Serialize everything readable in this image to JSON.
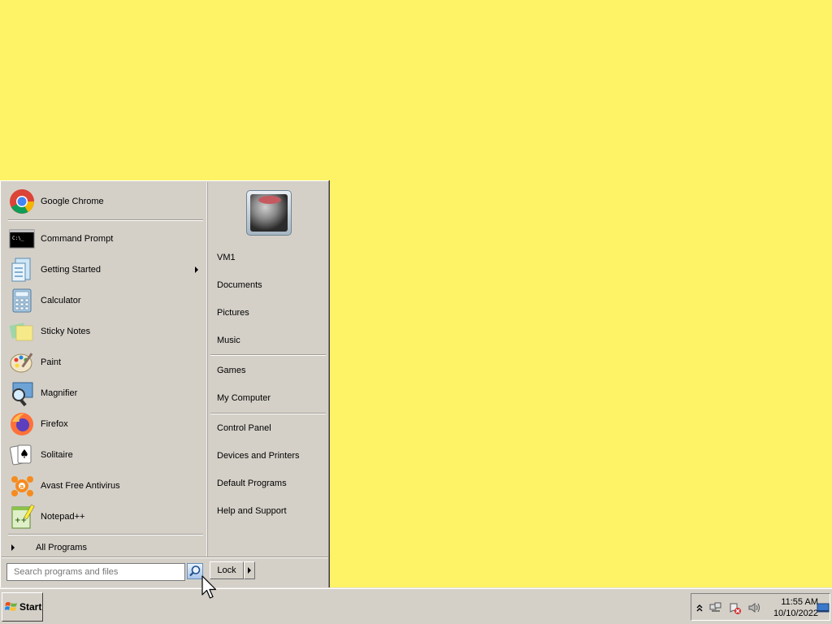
{
  "start_menu": {
    "pinned": [
      {
        "label": "Google Chrome",
        "icon": "chrome-icon"
      }
    ],
    "recent": [
      {
        "label": "Command Prompt",
        "icon": "command-prompt-icon"
      },
      {
        "label": "Getting Started",
        "icon": "getting-started-icon",
        "has_submenu": true
      },
      {
        "label": "Calculator",
        "icon": "calculator-icon"
      },
      {
        "label": "Sticky Notes",
        "icon": "sticky-notes-icon"
      },
      {
        "label": "Paint",
        "icon": "paint-icon"
      },
      {
        "label": "Magnifier",
        "icon": "magnifier-icon"
      },
      {
        "label": "Firefox",
        "icon": "firefox-icon"
      },
      {
        "label": "Solitaire",
        "icon": "solitaire-icon"
      },
      {
        "label": "Avast Free Antivirus",
        "icon": "avast-icon"
      },
      {
        "label": "Notepad++",
        "icon": "notepad-plus-plus-icon"
      }
    ],
    "all_programs": "All Programs",
    "search_placeholder": "Search programs and files",
    "places_group1": [
      "VM1",
      "Documents",
      "Pictures",
      "Music"
    ],
    "places_group2": [
      "Games",
      "My Computer"
    ],
    "places_group3": [
      "Control Panel",
      "Devices and Printers",
      "Default Programs",
      "Help and Support"
    ],
    "lock_label": "Lock"
  },
  "taskbar": {
    "start_label": "Start",
    "clock_time": "11:55 AM",
    "clock_date": "10/10/2022"
  },
  "colors": {
    "desktop": "#fef366",
    "menu_face": "#d4d0c8"
  }
}
